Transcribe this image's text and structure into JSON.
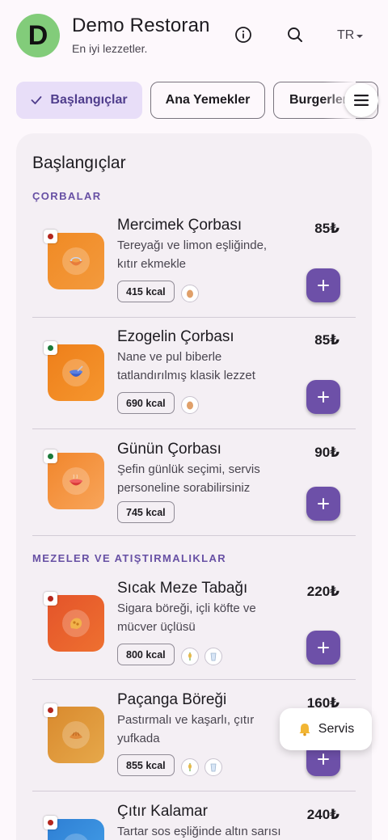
{
  "header": {
    "avatar_letter": "D",
    "restaurant_name": "Demo Restoran",
    "tagline": "En iyi lezzetler.",
    "language": "TR",
    "icons": [
      "info-icon",
      "search-icon",
      "chevron-down-icon"
    ]
  },
  "categories": [
    {
      "label": "Başlangıçlar",
      "active": true
    },
    {
      "label": "Ana Yemekler",
      "active": false
    },
    {
      "label": "Burgerler",
      "active": false
    }
  ],
  "section": {
    "title": "Başlangıçlar",
    "groups": [
      {
        "label": "ÇORBALAR"
      },
      {
        "label": "MEZELER VE ATIŞTIRMALIKLAR"
      }
    ]
  },
  "items": [
    {
      "name": "Mercimek Çorbası",
      "desc": "Tereyağı ve limon eşliğinde, kıtır ekmekle",
      "price": "85₺",
      "kcal": "415 kcal",
      "veg_color": "#b3261e",
      "thumb_colors": [
        "#f08a24",
        "#f39a3d"
      ],
      "allergens": [
        "egg-icon"
      ],
      "icon": "bowl-icon"
    },
    {
      "name": "Ezogelin Çorbası",
      "desc": "Nane ve pul biberle tatlandırılmış klasik lezzet",
      "price": "85₺",
      "kcal": "690 kcal",
      "veg_color": "#1b7a3a",
      "thumb_colors": [
        "#ee7f1a",
        "#f5962e"
      ],
      "allergens": [
        "egg-icon"
      ],
      "icon": "bowl-icon"
    },
    {
      "name": "Günün Çorbası",
      "desc": "Şefin günlük seçimi, servis personeline sorabilirsiniz",
      "price": "90₺",
      "kcal": "745 kcal",
      "veg_color": "#1b7a3a",
      "thumb_colors": [
        "#f1862c",
        "#f8a55a"
      ],
      "allergens": [],
      "icon": "soup-bowl-icon"
    },
    {
      "name": "Sıcak Meze Tabağı",
      "desc": "Sigara böreği, içli köfte ve mücver üçlüsü",
      "price": "220₺",
      "kcal": "800 kcal",
      "veg_color": "#b3261e",
      "thumb_colors": [
        "#e4542a",
        "#ee7030"
      ],
      "allergens": [
        "gluten-icon",
        "milk-icon"
      ],
      "icon": "plate-icon"
    },
    {
      "name": "Paçanga Böreği",
      "desc": "Pastırmalı ve kaşarlı, çıtır yufkada",
      "price": "160₺",
      "kcal": "855 kcal",
      "veg_color": "#b3261e",
      "thumb_colors": [
        "#d98a2e",
        "#e6a84a"
      ],
      "allergens": [
        "gluten-icon",
        "milk-icon"
      ],
      "icon": "pastry-icon"
    },
    {
      "name": "Çıtır Kalamar",
      "desc": "Tartar sos eşliğinde altın sarısı",
      "price": "240₺",
      "kcal": "",
      "veg_color": "#b3261e",
      "thumb_colors": [
        "#2e7fd4",
        "#45a0e8"
      ],
      "allergens": [],
      "icon": "squid-icon"
    }
  ],
  "fab": {
    "label": "Servis",
    "icon": "bell-icon"
  },
  "colors": {
    "primary": "#6d50a8",
    "active_chip": "#e8def8",
    "card_bg": "#f4eff4",
    "avatar": "#82cc7a"
  }
}
